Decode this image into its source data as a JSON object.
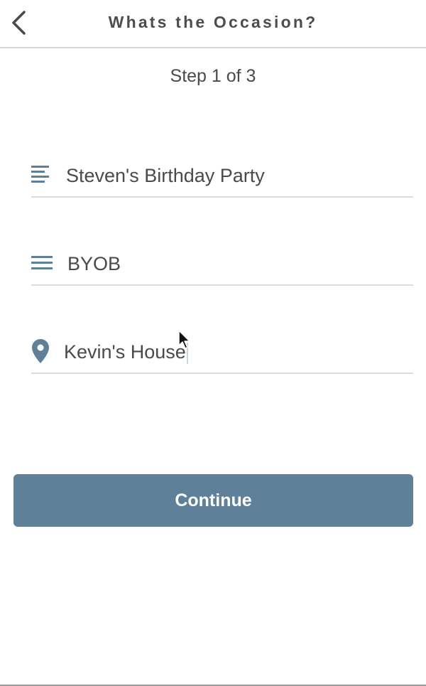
{
  "header": {
    "title": "Whats the Occasion?",
    "back_icon": "chevron-left-icon"
  },
  "step": {
    "text": "Step 1 of 3"
  },
  "form": {
    "name_field": {
      "value": "Steven's Birthday Party",
      "icon": "text-lines-icon"
    },
    "description_field": {
      "value": "BYOB",
      "icon": "menu-lines-icon"
    },
    "location_field": {
      "value": "Kevin's House",
      "icon": "location-pin-icon"
    }
  },
  "actions": {
    "continue_label": "Continue"
  },
  "colors": {
    "accent": "#5f8099",
    "text": "#4a4a4a",
    "divider": "#dcdcdc"
  }
}
